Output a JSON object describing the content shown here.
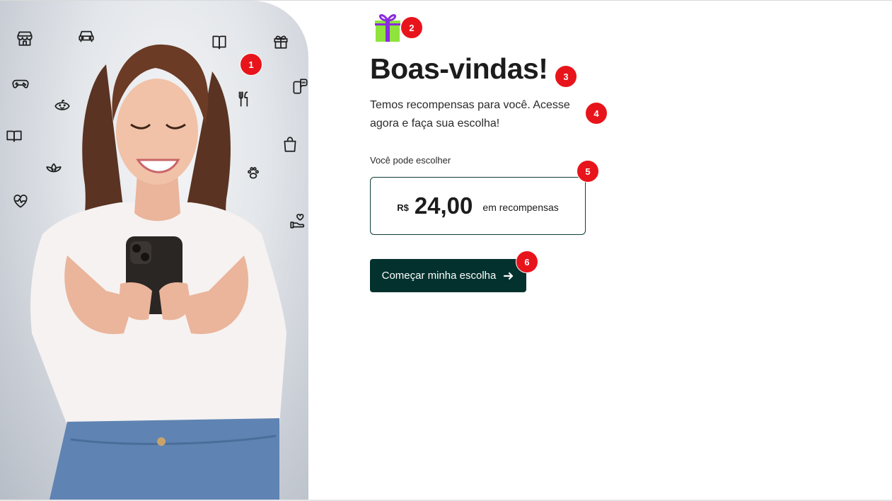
{
  "hero": {
    "icons": [
      "store-icon",
      "car-icon",
      "book-icon",
      "gift-outline-icon",
      "gamepad-icon",
      "cutlery-icon",
      "phone-chat-icon",
      "baby-face-icon",
      "open-book-icon",
      "shopping-bag-icon",
      "lotus-icon",
      "paw-icon",
      "heart-pulse-icon",
      "hand-heart-icon"
    ]
  },
  "welcome": {
    "title": "Boas-vindas!",
    "subtitle": "Temos recompensas para você. Acesse agora e faça sua escolha!"
  },
  "rewards": {
    "label": "Você pode escolher",
    "currency": "R$",
    "amount": "24,00",
    "suffix": "em recompensas"
  },
  "cta": {
    "label": "Começar minha escolha"
  },
  "markers": [
    "1",
    "2",
    "3",
    "4",
    "5",
    "6"
  ],
  "colors": {
    "primary": "#02312e",
    "marker": "#e8141b",
    "gift_box": "#8fe33c",
    "gift_ribbon": "#8a2be2"
  }
}
